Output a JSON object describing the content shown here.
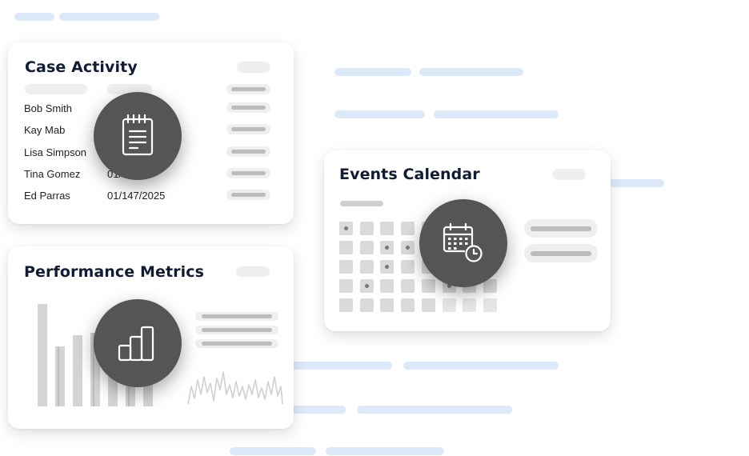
{
  "case_activity": {
    "title": "Case Activity",
    "rows": [
      {
        "name": "Bob Smith",
        "date": ""
      },
      {
        "name": "Kay Mab",
        "date": ""
      },
      {
        "name": "Lisa Simpson",
        "date": ""
      },
      {
        "name": "Tina Gomez",
        "date": "01/"
      },
      {
        "name": "Ed Parras",
        "date": "01/147/2025"
      }
    ],
    "icon": "notepad-icon"
  },
  "performance_metrics": {
    "title": "Performance Metrics",
    "icon": "bar-chart-icon"
  },
  "events_calendar": {
    "title": "Events Calendar",
    "icon": "calendar-clock-icon"
  },
  "colors": {
    "title_text": "#0f1c33",
    "icon_circle": "#555555",
    "background_lines": "#dce9f8",
    "placeholder_bar": "#bcbcbc"
  }
}
